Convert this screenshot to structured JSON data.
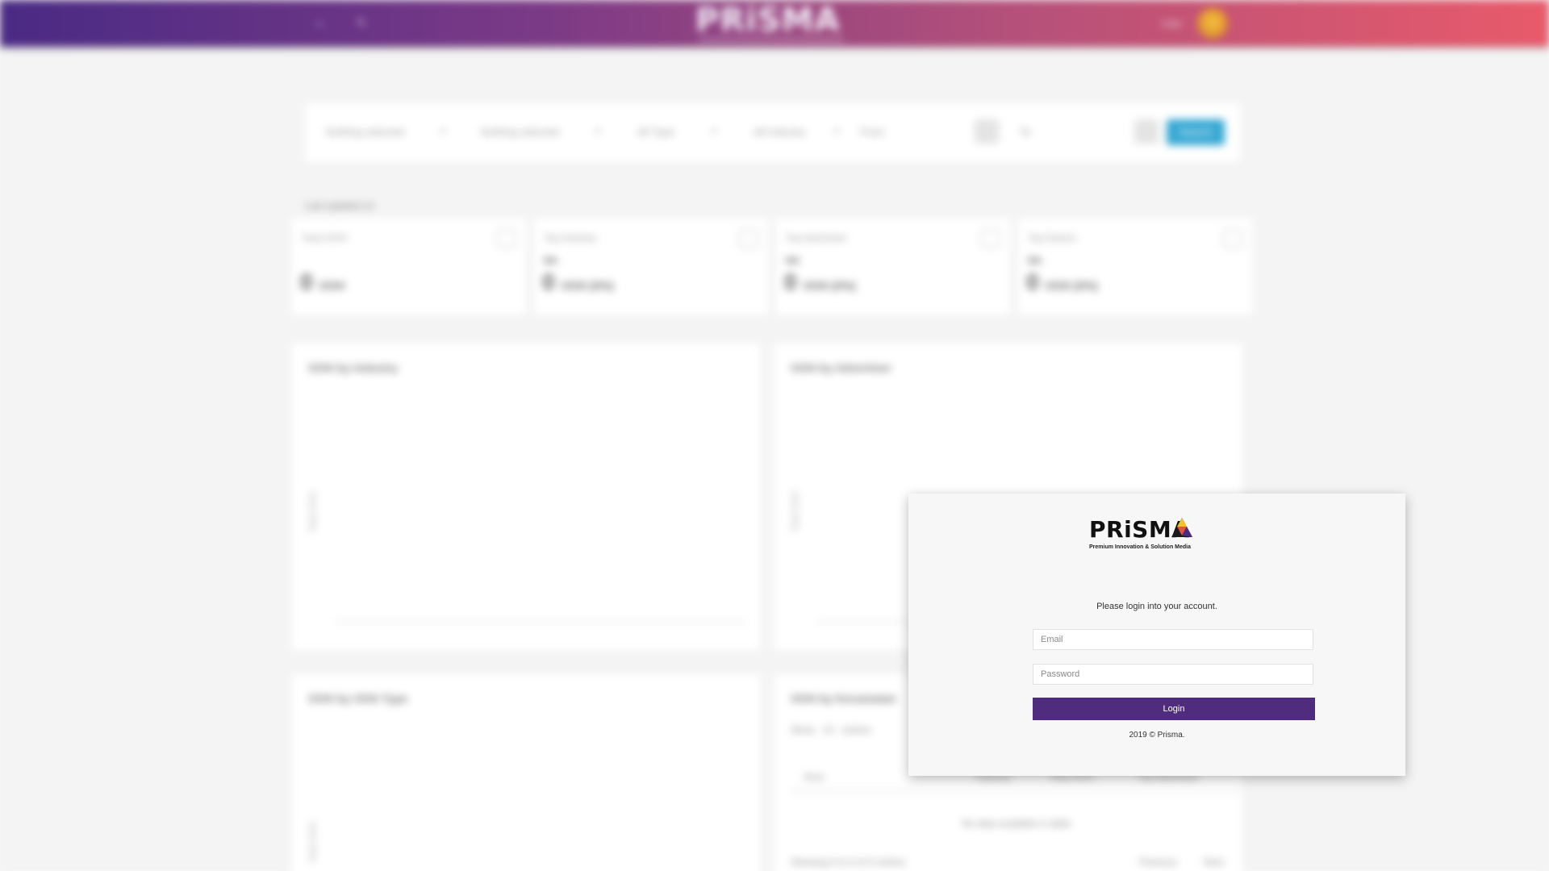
{
  "header": {
    "brand": "PRiSMA",
    "user_name": "User"
  },
  "filters": {
    "advertiser_placeholder": "Nothing selected",
    "brand_placeholder": "Nothing selected",
    "type_placeholder": "All Type",
    "industry_placeholder": "All Industry",
    "from_label": "From",
    "to_label": "To",
    "search_label": "Search"
  },
  "dashboard": {
    "last_updated": "Last updated on",
    "stats": [
      {
        "label": "Total OOH",
        "note": "",
        "value": "0",
        "unit": "OOH"
      },
      {
        "label": "Top Industry",
        "note": "NA",
        "value": "0",
        "unit": "OOH (0%)"
      },
      {
        "label": "Top Advertiser",
        "note": "NA",
        "value": "0",
        "unit": "OOH (0%)"
      },
      {
        "label": "Top District",
        "note": "NA",
        "value": "0",
        "unit": "OOH (0%)"
      }
    ],
    "panels": {
      "by_industry": "OOH by Industry",
      "by_advertiser": "OOH by Advertiser",
      "by_type": "OOH by OOH Type",
      "by_location": "OOH by Kecamatan",
      "y_axis": "Total OOH"
    },
    "table": {
      "show_label": "Show",
      "entries_value": "10",
      "entries_label": "entries",
      "headers": [
        "Area",
        "Industry",
        "Total OOH",
        "Top Advertiser"
      ],
      "empty_message": "No data available in table",
      "info": "Showing 0 to 0 of 0 entries",
      "prev_label": "Previous",
      "next_label": "Next"
    }
  },
  "login": {
    "logo_text": "PRiSMA",
    "tagline": "Premium Innovation & Solution Media",
    "prompt": "Please login into your account.",
    "email_placeholder": "Email",
    "password_placeholder": "Password",
    "login_label": "Login",
    "copyright": "2019 © Prisma."
  },
  "colors": {
    "header_gradient_start": "#4a2a84",
    "header_gradient_end": "#e85a6a",
    "login_button": "#4f2c7d",
    "search_button": "#35a7d3"
  }
}
